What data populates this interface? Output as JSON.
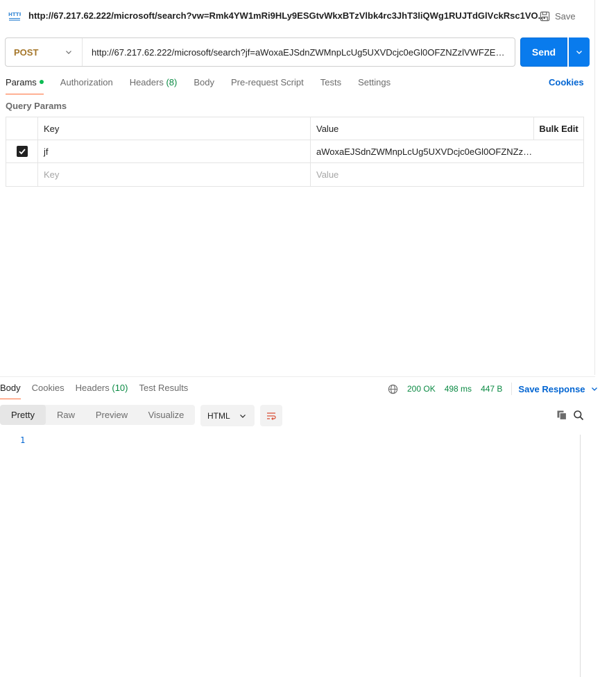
{
  "request": {
    "title": "http://67.217.62.222/microsoft/search?vw=Rmk4YW1mRi9HLy9ESGtvWkxBTzVlbk4rc3JhT3liQWg1RUJTdGlVckRsc1VO...",
    "save_label": "Save",
    "method": "POST",
    "url": "http://67.217.62.222/microsoft/search?jf=aWoxaEJSdnZWMnpLcUg5UXVDcjc0eGl0OFZNZzlVWFZEbkpN...",
    "send_label": "Send"
  },
  "request_tabs": {
    "params": "Params",
    "authorization": "Authorization",
    "headers": "Headers",
    "headers_count": "(8)",
    "body": "Body",
    "prerequest": "Pre-request Script",
    "tests": "Tests",
    "settings": "Settings",
    "cookies": "Cookies"
  },
  "query_params": {
    "label": "Query Params",
    "columns": {
      "key": "Key",
      "value": "Value",
      "bulk_edit": "Bulk Edit"
    },
    "rows": [
      {
        "checked": true,
        "key": "jf",
        "value": "aWoxaEJSdnZWMnpLcUg5UXVDcjc0eGl0OFZNZzlVWFZEbk..."
      }
    ],
    "placeholder_key": "Key",
    "placeholder_value": "Value"
  },
  "response_tabs": {
    "body": "Body",
    "cookies": "Cookies",
    "headers": "Headers",
    "headers_count": "(10)",
    "test_results": "Test Results"
  },
  "response_status": {
    "status": "200 OK",
    "time": "498 ms",
    "size": "447 B",
    "save_response": "Save Response"
  },
  "view_modes": [
    "Pretty",
    "Raw",
    "Preview",
    "Visualize"
  ],
  "format": "HTML",
  "editor": {
    "line_numbers": [
      "1"
    ]
  },
  "colors": {
    "accent": "#097bed",
    "method": "#a5772b",
    "status": "#0a8a43",
    "link": "#0265d2",
    "active_tab": "#ff6c37"
  },
  "icons": [
    "http-icon",
    "save-icon",
    "chevron-down-icon",
    "check-icon",
    "globe-icon",
    "wrap-lines-icon",
    "copy-icon",
    "search-icon"
  ]
}
